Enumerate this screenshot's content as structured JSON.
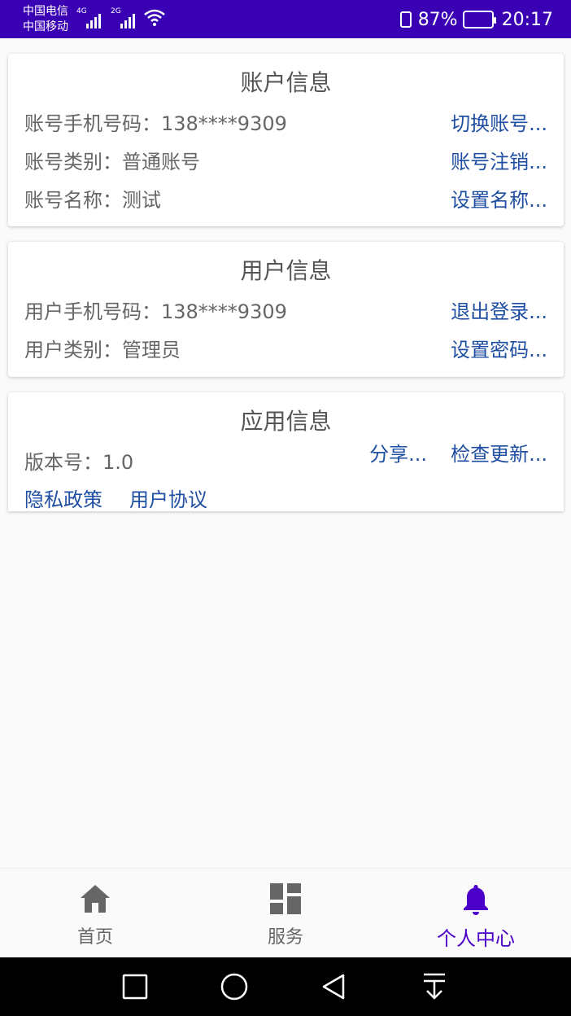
{
  "status_bar": {
    "carrier1": "中国电信",
    "carrier2": "中国移动",
    "sim1_tech": "4G",
    "sim2_tech": "2G",
    "battery_percent": "87%",
    "battery_level": 0.87,
    "time": "20:17"
  },
  "account_card": {
    "title": "账户信息",
    "phone": "账号手机号码：138****9309",
    "type": "账号类别：普通账号",
    "name": "账号名称：测试",
    "switch_account": "切换账号...",
    "cancel_account": "账号注销...",
    "set_name": "设置名称..."
  },
  "user_card": {
    "title": "用户信息",
    "phone": "用户手机号码：138****9309",
    "type": "用户类别：管理员",
    "logout": "退出登录...",
    "set_password": "设置密码..."
  },
  "app_card": {
    "title": "应用信息",
    "version": "版本号：1.0",
    "share": "分享...",
    "check_update": "检查更新...",
    "privacy": "隐私政策",
    "agreement": "用户协议"
  },
  "bottom_nav": {
    "items": [
      {
        "label": "首页",
        "icon": "home-icon"
      },
      {
        "label": "服务",
        "icon": "dashboard-icon"
      },
      {
        "label": "个人中心",
        "icon": "bell-icon"
      }
    ],
    "active_color": "#4a00c8",
    "inactive_color": "#666666"
  },
  "colors": {
    "status_bar": "#3a00b4",
    "link": "#1f4fa2"
  }
}
